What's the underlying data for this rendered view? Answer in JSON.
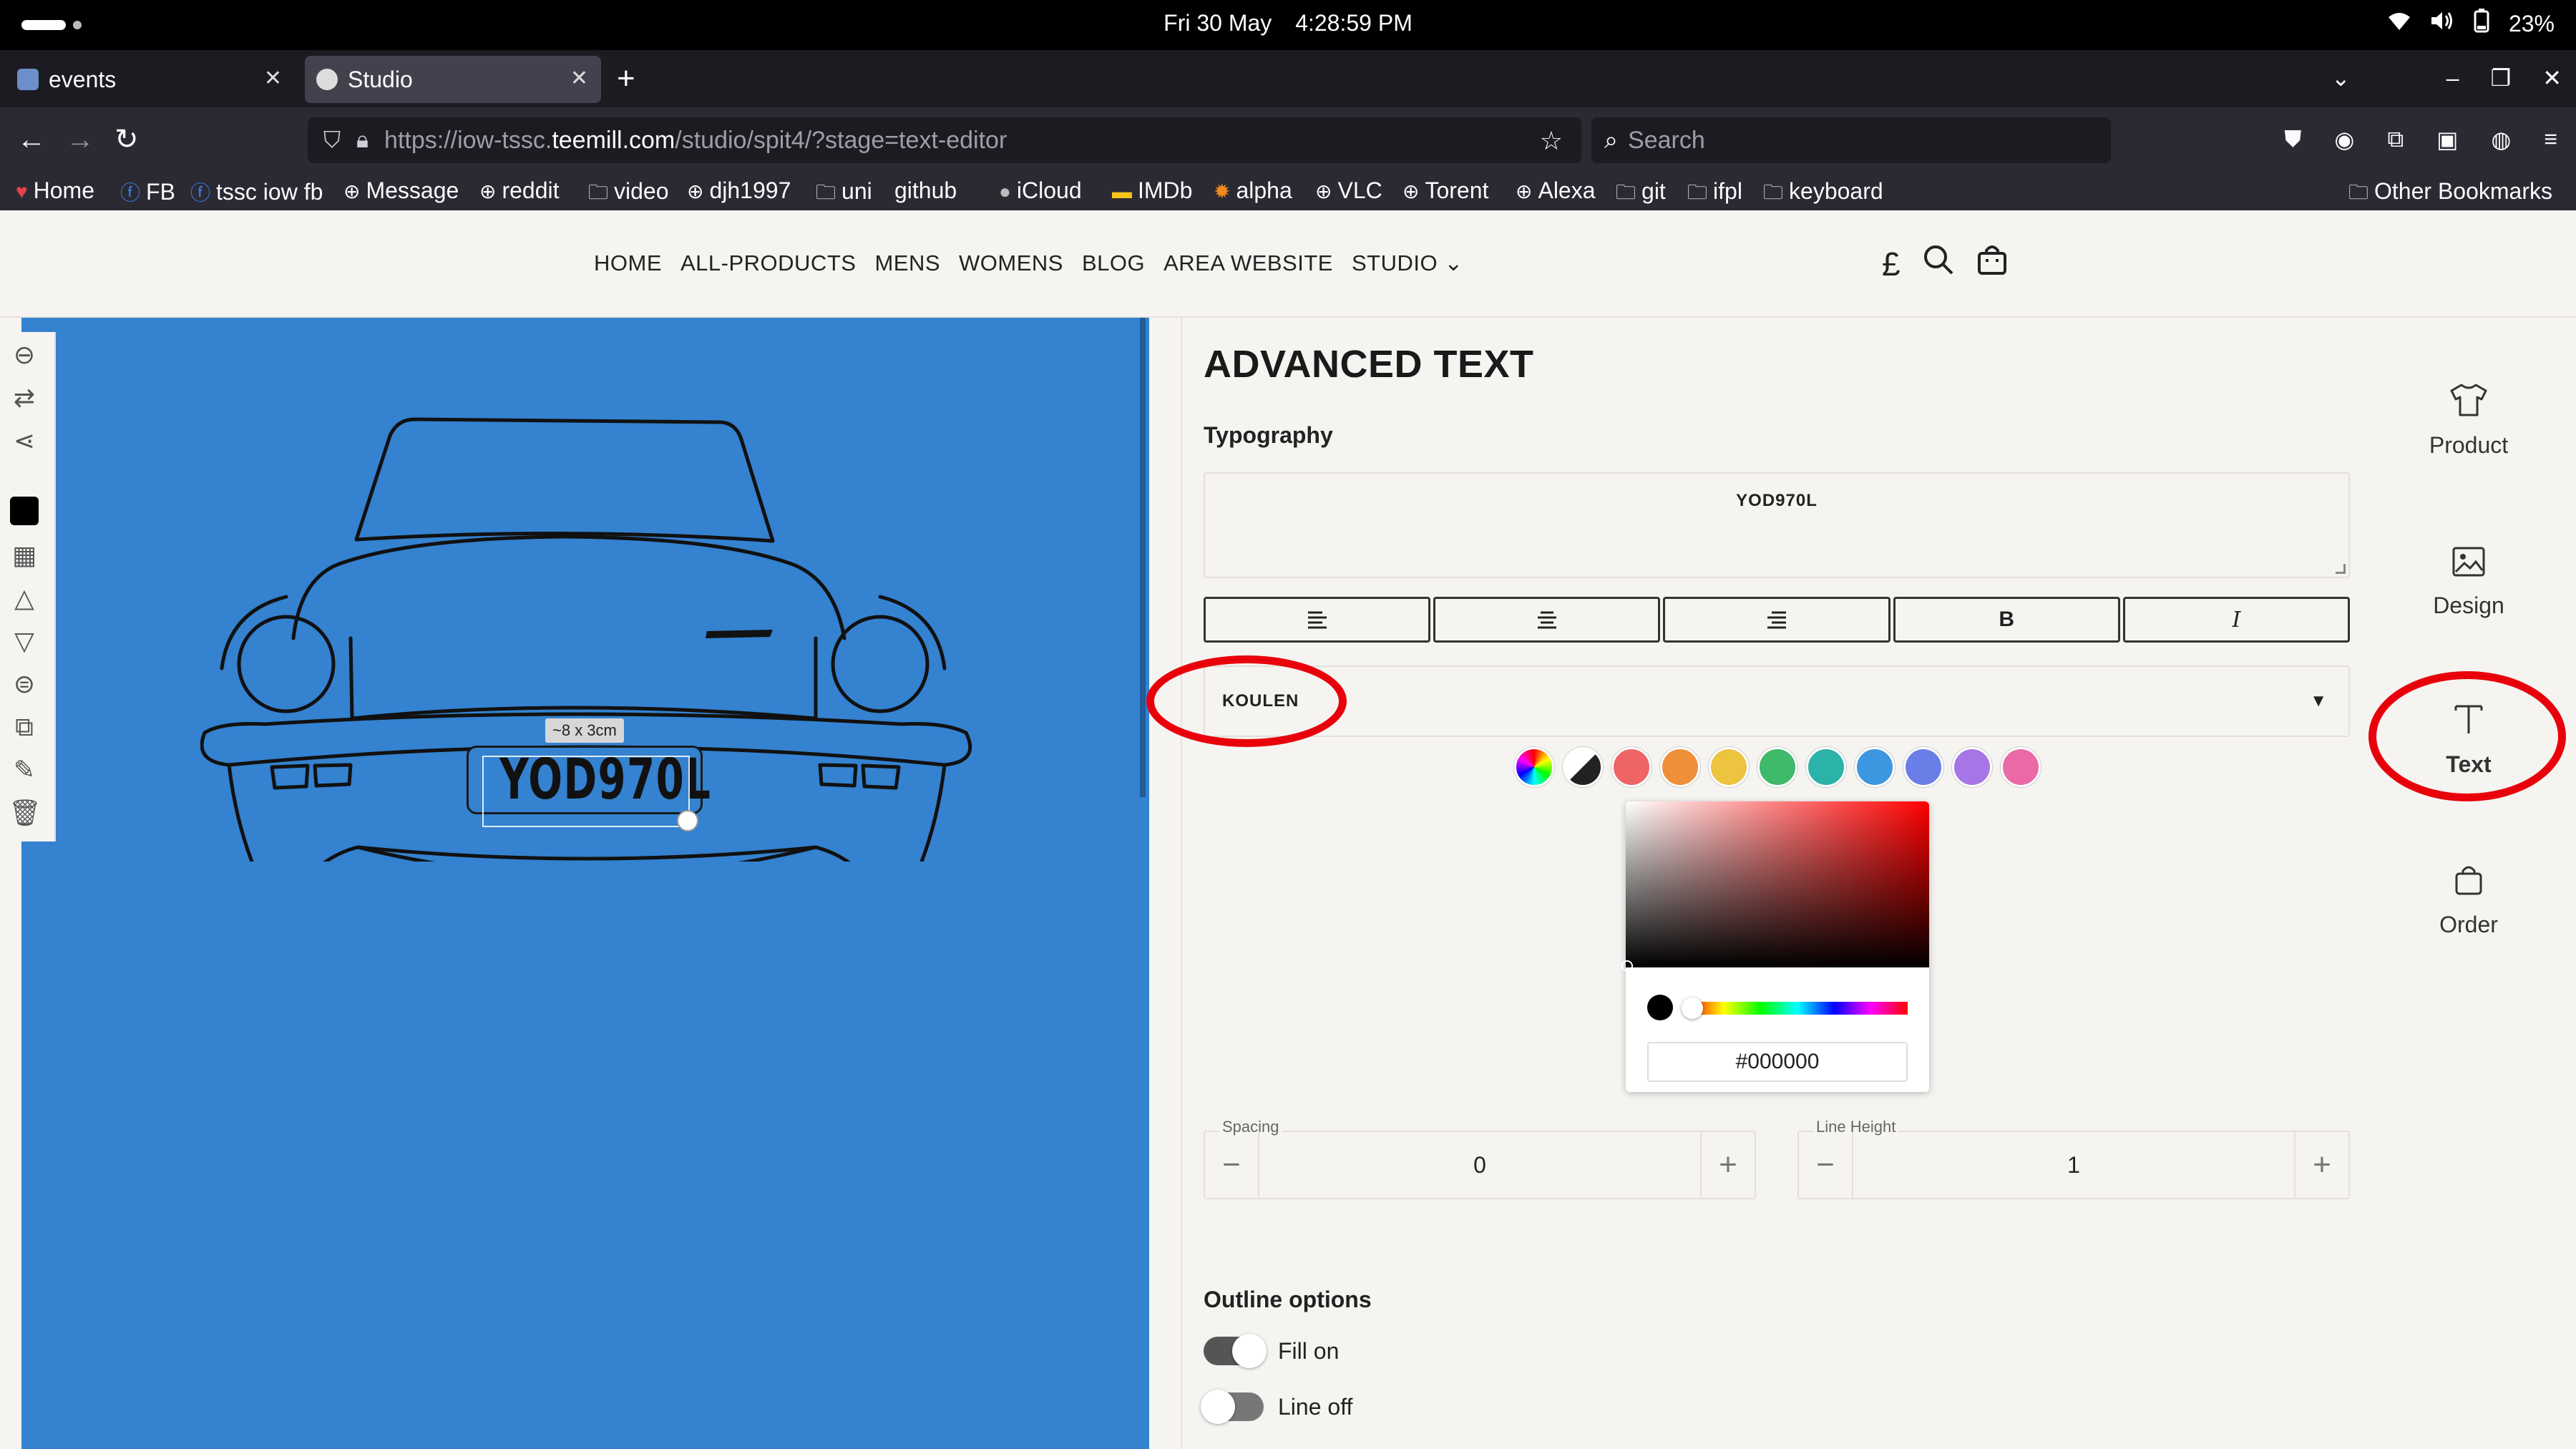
{
  "statusbar": {
    "date": "Fri 30 May",
    "time": "4:28:59 PM",
    "battery": "23%"
  },
  "tabs": [
    {
      "label": "events",
      "active": false
    },
    {
      "label": "Studio",
      "active": true
    }
  ],
  "urlbar": {
    "url_prefix": "https://iow-tssc.",
    "url_domain": "teemill.com",
    "url_suffix": "/studio/spit4/?stage=text-editor",
    "search_placeholder": "Search"
  },
  "bookmarks": [
    {
      "label": "Home",
      "icon": "heart-icon"
    },
    {
      "label": "FB",
      "icon": "facebook-icon"
    },
    {
      "label": "tssc iow fb",
      "icon": "facebook-icon"
    },
    {
      "label": "Message",
      "icon": "globe-icon"
    },
    {
      "label": "reddit",
      "icon": "globe-icon"
    },
    {
      "label": "video",
      "icon": "folder-icon"
    },
    {
      "label": "djh1997",
      "icon": "globe-icon"
    },
    {
      "label": "uni",
      "icon": "folder-icon"
    },
    {
      "label": "github",
      "icon": "github-icon"
    },
    {
      "label": "iCloud",
      "icon": "apple-icon"
    },
    {
      "label": "IMDb",
      "icon": "imdb-icon"
    },
    {
      "label": "alpha",
      "icon": "alpha-icon"
    },
    {
      "label": "VLC",
      "icon": "globe-icon"
    },
    {
      "label": "Torent",
      "icon": "globe-icon"
    },
    {
      "label": "Alexa",
      "icon": "globe-icon"
    },
    {
      "label": "git",
      "icon": "folder-icon"
    },
    {
      "label": "ifpl",
      "icon": "folder-icon"
    },
    {
      "label": "keyboard",
      "icon": "folder-icon"
    }
  ],
  "other_bookmarks": "Other Bookmarks",
  "site_nav": [
    "HOME",
    "ALL-PRODUCTS",
    "MENS",
    "WOMENS",
    "BLOG",
    "AREA WEBSITE",
    "STUDIO"
  ],
  "header_icons": {
    "currency": "£"
  },
  "canvas": {
    "background_color": "#3482d0",
    "size_tag": "~8 x 3cm",
    "plate_text": "YOD970L"
  },
  "editor": {
    "title": "ADVANCED TEXT",
    "typography_label": "Typography",
    "text_value": "YOD970L",
    "format_buttons": {
      "bold": "B",
      "italic": "I"
    },
    "font_value": "KOULEN",
    "swatch_colors": [
      "#ef6464",
      "#ef8f3a",
      "#ecc440",
      "#3fb96a",
      "#2bb3a9",
      "#3d96e0",
      "#6a7ee8",
      "#a776e6",
      "#ea6aa8"
    ],
    "picker_hex": "#000000",
    "spacing": {
      "label": "Spacing",
      "value": "0"
    },
    "line_height": {
      "label": "Line Height",
      "value": "1"
    },
    "outline_title": "Outline options",
    "fill_label": "Fill on",
    "line_label": "Line off"
  },
  "rail": {
    "product": "Product",
    "design": "Design",
    "text": "Text",
    "order": "Order"
  }
}
